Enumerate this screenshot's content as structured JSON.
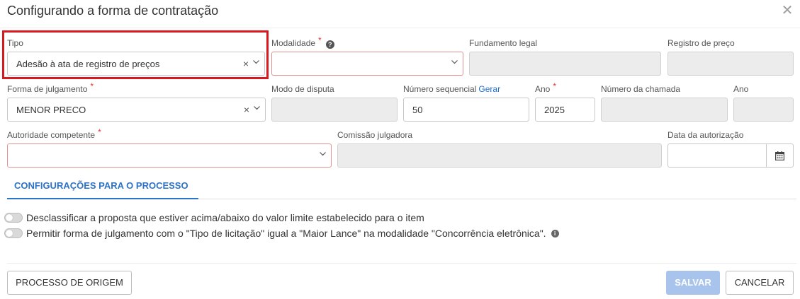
{
  "modal": {
    "title": "Configurando a forma de contratação",
    "close_icon": "close-icon"
  },
  "fields": {
    "tipo": {
      "label": "Tipo",
      "value": "Adesão à ata de registro de preços"
    },
    "modalidade": {
      "label": "Modalidade",
      "value": ""
    },
    "fundamento_legal": {
      "label": "Fundamento legal",
      "value": ""
    },
    "registro_preco": {
      "label": "Registro de preço",
      "value": ""
    },
    "forma_julgamento": {
      "label": "Forma de julgamento",
      "value": "MENOR PRECO"
    },
    "modo_disputa": {
      "label": "Modo de disputa",
      "value": ""
    },
    "numero_sequencial": {
      "label": "Número sequencial",
      "link": "Gerar",
      "value": "50"
    },
    "ano": {
      "label": "Ano",
      "value": "2025"
    },
    "numero_chamada": {
      "label": "Número da chamada",
      "value": ""
    },
    "ano2": {
      "label": "Ano",
      "value": ""
    },
    "autoridade": {
      "label": "Autoridade competente",
      "value": ""
    },
    "comissao": {
      "label": "Comissão julgadora",
      "value": ""
    },
    "data_autorizacao": {
      "label": "Data da autorização",
      "value": ""
    }
  },
  "tabs": [
    {
      "label": "CONFIGURAÇÕES PARA O PROCESSO",
      "active": true
    }
  ],
  "options": [
    {
      "label": "Desclassificar a proposta que estiver acima/abaixo do valor limite estabelecido para o item",
      "enabled": false
    },
    {
      "label": "Permitir forma de julgamento com o \"Tipo de licitação\" igual a \"Maior Lance\" na modalidade \"Concorrência eletrônica\".",
      "enabled": false
    }
  ],
  "footer": {
    "origin_button": "PROCESSO DE ORIGEM",
    "save_button": "SALVAR",
    "cancel_button": "CANCELAR"
  },
  "colors": {
    "accent": "#2d73c8",
    "required": "#e53935",
    "highlight": "#d71920",
    "save_disabled": "#a8c4ec"
  }
}
